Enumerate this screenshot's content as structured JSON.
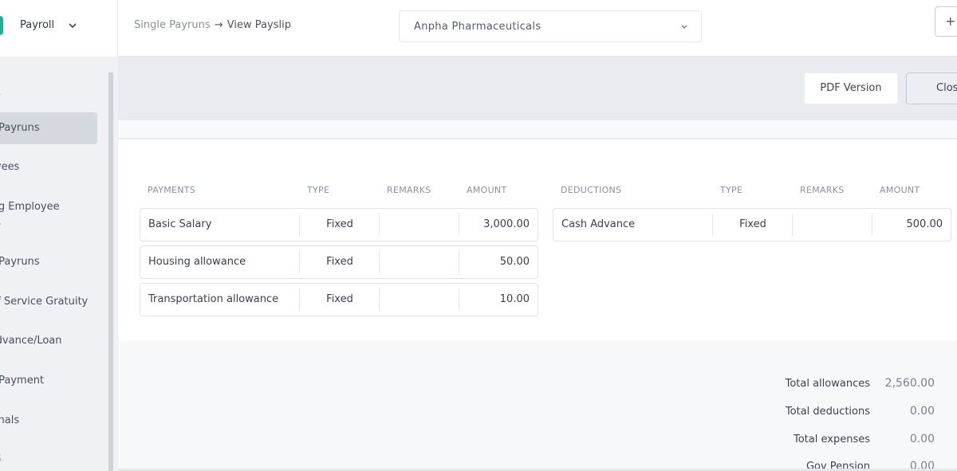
{
  "brand": {
    "name": "Payroll",
    "color": "#1ab394"
  },
  "breadcrumb": {
    "parent": "Single Payruns",
    "arrow": "→",
    "current": "View Payslip"
  },
  "company_select": {
    "value": "Anpha Pharmaceuticals"
  },
  "topbar": {
    "plus_label": "+"
  },
  "sidebar": {
    "section": "LL",
    "items": [
      {
        "label": "e Payruns",
        "active": true
      },
      {
        "label": "oyees"
      },
      {
        "label": "ing Employee",
        "label2": "gs"
      },
      {
        "label": "e Payruns"
      },
      {
        "label": "Of Service Gratuity"
      },
      {
        "label": "Advance/Loan"
      },
      {
        "label": "e Payment"
      },
      {
        "label": "ionals"
      }
    ],
    "muted": "TS"
  },
  "actions": {
    "pdf": "PDF Version",
    "close": "Close"
  },
  "payments": {
    "headers": [
      "PAYMENTS",
      "TYPE",
      "REMARKS",
      "AMOUNT"
    ],
    "rows": [
      {
        "name": "Basic Salary",
        "type": "Fixed",
        "remarks": "",
        "amount": "3,000.00"
      },
      {
        "name": "Housing allowance",
        "type": "Fixed",
        "remarks": "",
        "amount": "50.00"
      },
      {
        "name": "Transportation allowance",
        "type": "Fixed",
        "remarks": "",
        "amount": "10.00"
      }
    ]
  },
  "deductions": {
    "headers": [
      "DEDUCTIONS",
      "TYPE",
      "REMARKS",
      "AMOUNT"
    ],
    "rows": [
      {
        "name": "Cash Advance",
        "type": "Fixed",
        "remarks": "",
        "amount": "500.00"
      }
    ]
  },
  "totals": [
    {
      "label": "Total allowances",
      "value": "2,560.00"
    },
    {
      "label": "Total deductions",
      "value": "0.00"
    },
    {
      "label": "Total expenses",
      "value": "0.00"
    },
    {
      "label": "Gov Pension",
      "value": "0.00"
    }
  ]
}
